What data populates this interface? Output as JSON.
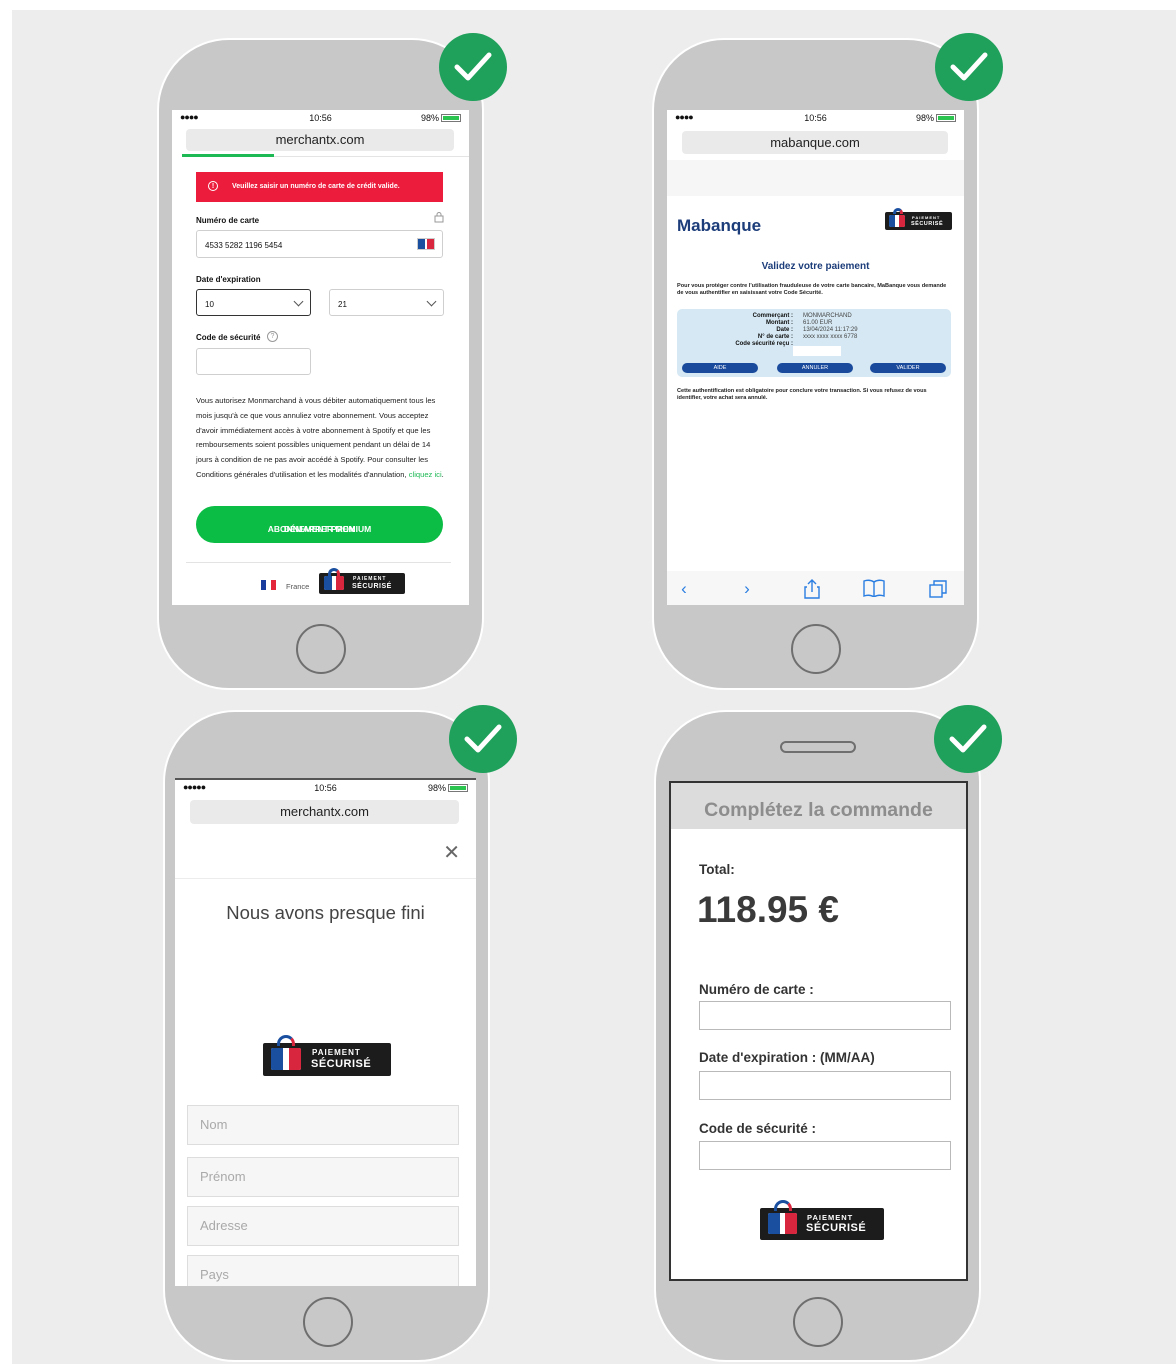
{
  "colors": {
    "check": "#1fa05b",
    "error": "#ec1c3c",
    "cta": "#0bbd44",
    "bank_blue": "#1c3d7a"
  },
  "status": {
    "signal": "●●●●",
    "signal5": "●●●●●",
    "time": "10:56",
    "battery": "98%"
  },
  "badge": {
    "line1": "PAIEMENT",
    "line2": "SÉCURISÉ"
  },
  "phone1": {
    "url": "merchantx.com",
    "error": "Veuillez saisir un numéro de carte de crédit valide.",
    "card_label": "Numéro de carte",
    "card_value": "4533 5282 1196 5454",
    "expiry_label": "Date d'expiration",
    "month": "10",
    "year": "21",
    "cvc_label": "Code de sécurité",
    "help_icon": "?",
    "terms": "Vous autorisez Monmarchand à vous débiter automatiquement tous les mois jusqu'à ce que vous annuliez votre abonnement. Vous acceptez d'avoir immédiatement accès à votre abonnement à Spotify et que les remboursements soient possibles uniquement pendant un délai de 14 jours à condition de ne pas avoir accédé à Spotify. Pour consulter les Conditions générales d'utilisation et les modalités d'annulation,",
    "terms_link": "cliquez ici",
    "terms_end": ".",
    "cta_line1": "DÉMARRER MON",
    "cta_line2": "ABONNEMENT PREMIUM",
    "country": "France"
  },
  "phone2": {
    "url": "mabanque.com",
    "brand": "Mabanque",
    "title": "Validez votre paiement",
    "intro": "Pour vous protéger contre l'utilisation frauduleuse de votre carte bancaire, MaBanque vous demande de vous authentifier en saisissant votre Code Sécurité.",
    "rows": [
      {
        "k": "Commerçant :",
        "v": "MONMARCHAND"
      },
      {
        "k": "Montant :",
        "v": "61.00 EUR"
      },
      {
        "k": "Date :",
        "v": "13/04/2024 11:17:29"
      },
      {
        "k": "N° de carte :",
        "v": "xxxx xxxx xxxx 6778"
      },
      {
        "k": "Code sécurité reçu :",
        "v": ""
      }
    ],
    "buttons": [
      "AIDE",
      "ANNULER",
      "VALIDER"
    ],
    "note": "Cette authentification est obligatoire pour conclure votre transaction. Si vous refusez de vous identifier, votre achat sera annulé.",
    "toolbar_icons": [
      "back-icon",
      "forward-icon",
      "share-icon",
      "bookmarks-icon",
      "tabs-icon"
    ]
  },
  "phone3": {
    "url": "merchantx.com",
    "title": "Nous avons presque fini",
    "fields": [
      "Nom",
      "Prénom",
      "Adresse",
      "Pays"
    ]
  },
  "phone4": {
    "header": "Complétez la commande",
    "total_label": "Total:",
    "total_value": "118.95 €",
    "card_label": "Numéro de carte :",
    "expiry_label": "Date d'expiration : (MM/AA)",
    "cvc_label": "Code de sécurité :"
  }
}
